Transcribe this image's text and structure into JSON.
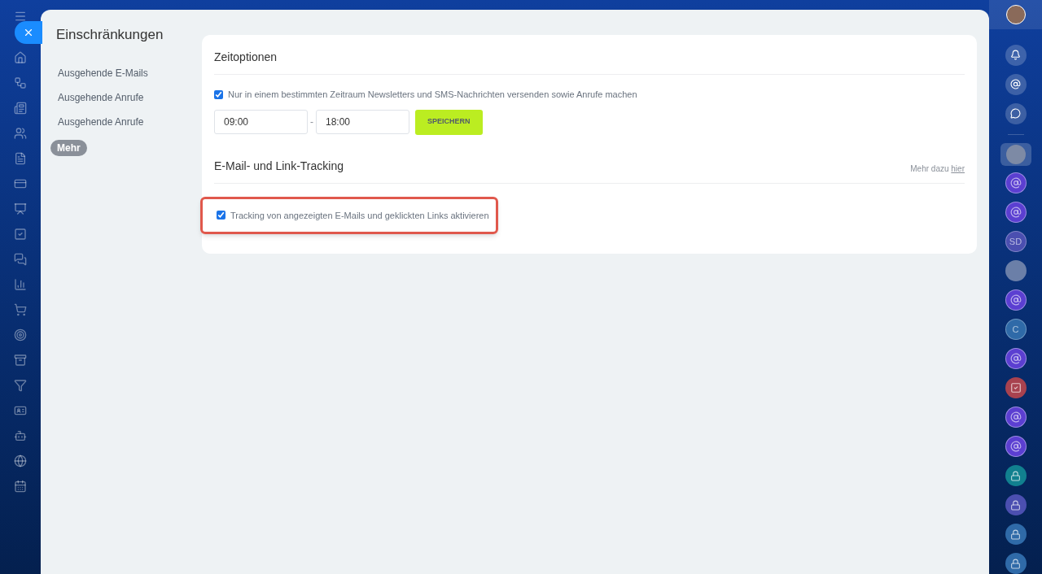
{
  "panel": {
    "title": "Einschränkungen"
  },
  "menu": [
    {
      "label": "Ausgehende E-Mails",
      "selected": false
    },
    {
      "label": "Ausgehende Anrufe",
      "selected": false
    },
    {
      "label": "Ausgehende Anrufe",
      "selected": false
    },
    {
      "label": "Mehr",
      "selected": true
    }
  ],
  "sections": [
    {
      "title": "Zeitoptionen",
      "options": [
        {
          "label": "Nur in einem bestimmten Zeitraum Newsletters und SMS-Nachrichten versenden sowie Anrufe machen",
          "checked": true,
          "highlighted": false
        }
      ],
      "time_range": {
        "from": "09:00",
        "separator": "-",
        "to": "18:00",
        "button": "SPEICHERN"
      }
    },
    {
      "title": "E-Mail- und Link-Tracking",
      "hint": "Mehr dazu",
      "hint_link": "hier",
      "options": [
        {
          "label": "Tracking von angezeigten E-Mails und geklickten Links aktivieren",
          "checked": true,
          "highlighted": true
        }
      ]
    }
  ],
  "right_bar": [
    {
      "kind": "openline",
      "color": "#5b3fd1"
    },
    {
      "kind": "openline",
      "color": "#5b3fd1"
    },
    {
      "kind": "initials",
      "text": "SD",
      "color": "#4b4fb0"
    },
    {
      "kind": "avatar",
      "color": "#6b7fa8"
    },
    {
      "kind": "openline",
      "color": "#5b3fd1"
    },
    {
      "kind": "initials",
      "text": "C",
      "color": "#2f6aa8"
    },
    {
      "kind": "openline",
      "color": "#5b3fd1"
    },
    {
      "kind": "task",
      "color": "#a8424f"
    },
    {
      "kind": "openline",
      "color": "#5b3fd1"
    },
    {
      "kind": "openline",
      "color": "#5b3fd1"
    },
    {
      "kind": "lock",
      "color": "#11808f"
    },
    {
      "kind": "lock",
      "color": "#4b4fb0"
    },
    {
      "kind": "lock",
      "color": "#2f6aa8"
    },
    {
      "kind": "lock",
      "color": "#2f6aa8"
    }
  ]
}
